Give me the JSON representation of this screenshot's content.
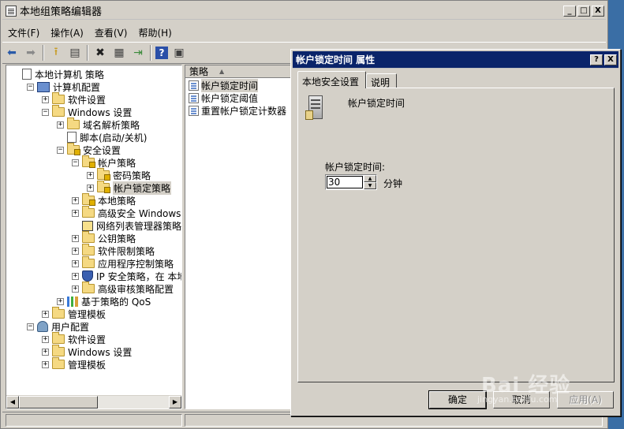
{
  "window": {
    "title": "本地组策略编辑器",
    "buttons": [
      "_",
      "□",
      "X"
    ]
  },
  "menu": [
    "文件(F)",
    "操作(A)",
    "查看(V)",
    "帮助(H)"
  ],
  "toolbar": {
    "icons": [
      "back-icon",
      "forward-icon",
      "up-folder-icon",
      "show-tree-icon",
      "delete-icon",
      "properties-icon",
      "export-icon",
      "help-icon",
      "view-icon"
    ]
  },
  "tree": [
    {
      "label": "本地计算机 策略",
      "icon": "doc",
      "exp": "none",
      "indent": 0
    },
    {
      "label": "计算机配置",
      "icon": "computer",
      "exp": "−",
      "indent": 1
    },
    {
      "label": "软件设置",
      "icon": "folder",
      "exp": "+",
      "indent": 2
    },
    {
      "label": "Windows 设置",
      "icon": "folder",
      "exp": "−",
      "indent": 2
    },
    {
      "label": "域名解析策略",
      "icon": "folder",
      "exp": "+",
      "indent": 3
    },
    {
      "label": "脚本(启动/关机)",
      "icon": "doc",
      "exp": "none",
      "indent": 3
    },
    {
      "label": "安全设置",
      "icon": "lockfolder",
      "exp": "−",
      "indent": 3
    },
    {
      "label": "帐户策略",
      "icon": "lockfolder",
      "exp": "−",
      "indent": 4
    },
    {
      "label": "密码策略",
      "icon": "lockfolder",
      "exp": "+",
      "indent": 5
    },
    {
      "label": "帐户锁定策略",
      "icon": "lockfolder",
      "exp": "+",
      "indent": 5,
      "selected": true
    },
    {
      "label": "本地策略",
      "icon": "lockfolder",
      "exp": "+",
      "indent": 4
    },
    {
      "label": "高级安全 Windows 防火",
      "icon": "folder",
      "exp": "+",
      "indent": 4
    },
    {
      "label": "网络列表管理器策略",
      "icon": "netlist",
      "exp": "none",
      "indent": 4
    },
    {
      "label": "公钥策略",
      "icon": "folder",
      "exp": "+",
      "indent": 4
    },
    {
      "label": "软件限制策略",
      "icon": "folder",
      "exp": "+",
      "indent": 4
    },
    {
      "label": "应用程序控制策略",
      "icon": "folder",
      "exp": "+",
      "indent": 4
    },
    {
      "label": "IP 安全策略，在 本地",
      "icon": "shield",
      "exp": "+",
      "indent": 4
    },
    {
      "label": "高级审核策略配置",
      "icon": "folder",
      "exp": "+",
      "indent": 4
    },
    {
      "label": "基于策略的 QoS",
      "icon": "chart",
      "exp": "+",
      "indent": 3
    },
    {
      "label": "管理模板",
      "icon": "folder",
      "exp": "+",
      "indent": 2
    },
    {
      "label": "用户配置",
      "icon": "user",
      "exp": "−",
      "indent": 1
    },
    {
      "label": "软件设置",
      "icon": "folder",
      "exp": "+",
      "indent": 2
    },
    {
      "label": "Windows 设置",
      "icon": "folder",
      "exp": "+",
      "indent": 2
    },
    {
      "label": "管理模板",
      "icon": "folder",
      "exp": "+",
      "indent": 2
    }
  ],
  "list": {
    "header": "策略",
    "rows": [
      {
        "label": "帐户锁定时间",
        "selected": true
      },
      {
        "label": "帐户锁定阈值",
        "selected": false
      },
      {
        "label": "重置帐户锁定计数器",
        "selected": false
      }
    ]
  },
  "dialog": {
    "title": "帐户锁定时间 属性",
    "buttons": [
      "?",
      "X"
    ],
    "tabs": [
      "本地安全设置",
      "说明"
    ],
    "policy_title": "帐户锁定时间",
    "field_label": "帐户锁定时间:",
    "value": "30",
    "unit": "分钟",
    "ok": "确定",
    "cancel": "取消",
    "apply": "应用(A)"
  },
  "watermark": {
    "text": "Bai 经验",
    "sub": "jingyan.baidu.com"
  }
}
